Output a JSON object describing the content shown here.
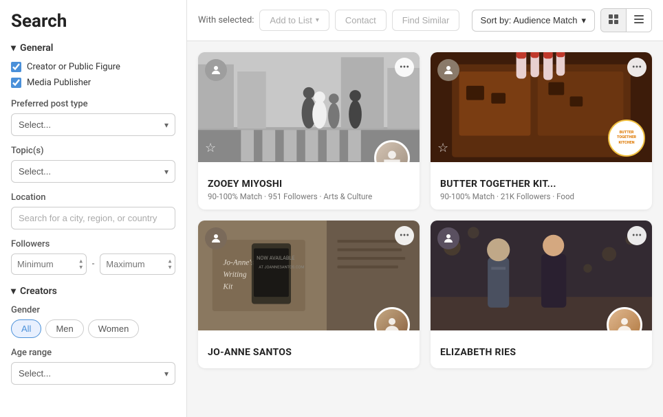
{
  "page": {
    "title": "Search"
  },
  "topbar": {
    "with_selected_label": "With selected:",
    "add_to_list_label": "Add to List",
    "contact_label": "Contact",
    "find_similar_label": "Find Similar",
    "sort_label": "Sort by: Audience Match",
    "grid_view_icon": "⊞",
    "list_view_icon": "☰"
  },
  "sidebar": {
    "general_section": "General",
    "creators_section": "Creators",
    "checkboxes": [
      {
        "id": "cb1",
        "label": "Creator or Public Figure",
        "checked": true
      },
      {
        "id": "cb2",
        "label": "Media Publisher",
        "checked": true
      }
    ],
    "preferred_post_type_label": "Preferred post type",
    "preferred_post_placeholder": "Select...",
    "topics_label": "Topic(s)",
    "topics_placeholder": "Select...",
    "location_label": "Location",
    "location_placeholder": "Search for a city, region, or country",
    "followers_label": "Followers",
    "followers_min_placeholder": "Minimum",
    "followers_max_placeholder": "Maximum",
    "gender_label": "Gender",
    "gender_options": [
      "All",
      "Men",
      "Women"
    ],
    "gender_active": "All",
    "age_range_label": "Age range",
    "age_range_placeholder": "Select..."
  },
  "creators": [
    {
      "id": 1,
      "name": "ZOOEY MIYOSHI",
      "match": "90-100% Match",
      "followers": "951 Followers",
      "category": "Arts & Culture",
      "bg_class": "card-bg-1",
      "profile_color": "#b0a090"
    },
    {
      "id": 2,
      "name": "Butter Together Kit...",
      "match": "90-100% Match",
      "followers": "21K Followers",
      "category": "Food",
      "bg_class": "card-bg-2",
      "profile_color": "#c0a080",
      "has_badge": true,
      "badge_text": "BUTTER\nTOGETHER\nKITCHEN"
    },
    {
      "id": 3,
      "name": "Jo-Anne Santos",
      "match": "",
      "followers": "",
      "category": "",
      "bg_class": "card-bg-3",
      "profile_color": "#a09080"
    },
    {
      "id": 4,
      "name": "Elizabeth Ries",
      "match": "",
      "followers": "",
      "category": "",
      "bg_class": "card-bg-4",
      "profile_color": "#c0a880"
    }
  ]
}
